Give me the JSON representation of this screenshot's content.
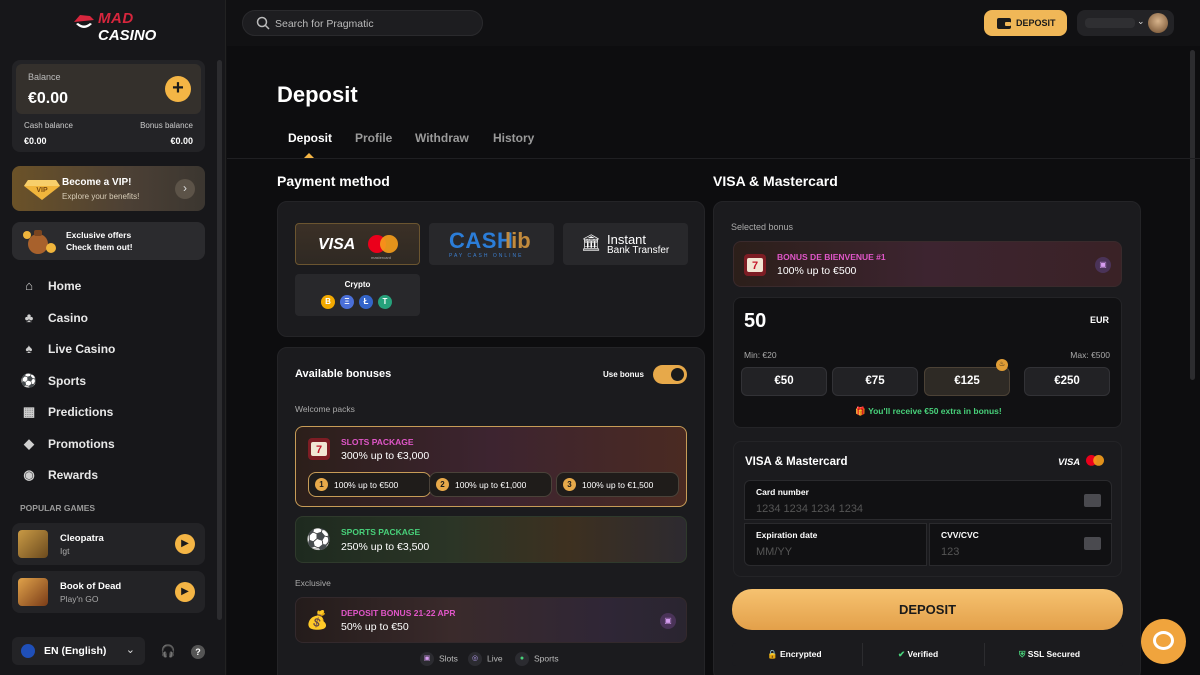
{
  "brand": {
    "line1": "MAD",
    "line2": "CASINO"
  },
  "balance": {
    "label": "Balance",
    "value": "€0.00",
    "cash_label": "Cash balance",
    "cash_value": "€0.00",
    "bonus_label": "Bonus balance",
    "bonus_value": "€0.00"
  },
  "vip": {
    "title": "Become a VIP!",
    "subtitle": "Explore your benefits!"
  },
  "offers": {
    "line1": "Exclusive offers",
    "line2": "Check them out!"
  },
  "nav": [
    {
      "label": "Home",
      "icon": "home-icon"
    },
    {
      "label": "Casino",
      "icon": "casino-icon"
    },
    {
      "label": "Live Casino",
      "icon": "live-casino-icon"
    },
    {
      "label": "Sports",
      "icon": "sports-icon"
    },
    {
      "label": "Predictions",
      "icon": "predictions-icon"
    },
    {
      "label": "Promotions",
      "icon": "promotions-icon"
    },
    {
      "label": "Rewards",
      "icon": "rewards-icon"
    }
  ],
  "popular": {
    "heading": "POPULAR GAMES",
    "games": [
      {
        "name": "Cleopatra",
        "provider": "Igt"
      },
      {
        "name": "Book of Dead",
        "provider": "Play'n GO"
      }
    ]
  },
  "language": "EN (English)",
  "search": {
    "placeholder": "Search for Pragmatic"
  },
  "header": {
    "deposit_label": "DEPOSIT"
  },
  "page": {
    "title": "Deposit",
    "tabs": [
      "Deposit",
      "Profile",
      "Withdraw",
      "History"
    ],
    "active_tab": "Deposit"
  },
  "payment": {
    "heading": "Payment method",
    "visa_text": "VISA",
    "mastercard_text": "mastercard",
    "cashlib_a": "CASH",
    "cashlib_b": "lib",
    "cashlib_sub": "PAY CASH ONLINE",
    "bank_line1": "Instant",
    "bank_line2": "Bank Transfer",
    "crypto_label": "Crypto",
    "crypto_coins": [
      "B",
      "Ξ",
      "Ł",
      "T"
    ]
  },
  "bonuses": {
    "heading": "Available bonuses",
    "use_bonus_label": "Use bonus",
    "use_bonus_on": true,
    "welcome_label": "Welcome packs",
    "slots": {
      "title": "SLOTS PACKAGE",
      "subtitle": "300% up to €3,000",
      "tiers": [
        {
          "num": "1",
          "text": "100% up to €500"
        },
        {
          "num": "2",
          "text": "100% up to €1,000"
        },
        {
          "num": "3",
          "text": "100% up to €1,500"
        }
      ]
    },
    "sports": {
      "title": "SPORTS PACKAGE",
      "subtitle": "250% up to €3,500"
    },
    "exclusive_label": "Exclusive",
    "deposit_bonus": {
      "title": "DEPOSIT BONUS 21-22 APR",
      "subtitle": "50% up to €50"
    },
    "categories": [
      "Slots",
      "Live",
      "Sports"
    ]
  },
  "visa_panel": {
    "heading": "VISA & Mastercard",
    "selected_bonus_label": "Selected bonus",
    "selected_bonus": {
      "title": "BONUS DE BIENVENUE #1",
      "subtitle": "100% up to €500"
    },
    "amount": "50",
    "currency": "EUR",
    "min": "Min: €20",
    "max": "Max: €500",
    "quick_amounts": [
      "€50",
      "€75",
      "€125",
      "€250"
    ],
    "selected_quick": "€125",
    "extra_text": "You'll receive €50 extra in bonus!",
    "card_title": "VISA & Mastercard",
    "card_visa": "VISA",
    "card_number_label": "Card number",
    "card_number_placeholder": "1234 1234 1234 1234",
    "expiry_label": "Expiration date",
    "expiry_placeholder": "MM/YY",
    "cvv_label": "CVV/CVC",
    "cvv_placeholder": "123",
    "deposit_button": "DEPOSIT",
    "trust": [
      "Encrypted",
      "Verified",
      "SSL Secured"
    ]
  },
  "colors": {
    "accent": "#f4b545",
    "bg": "#0d0d0f",
    "panel": "#1b1b1e",
    "brand_red": "#d7263d",
    "bonus_pink": "#e056c8",
    "sports_green": "#48d17a"
  }
}
